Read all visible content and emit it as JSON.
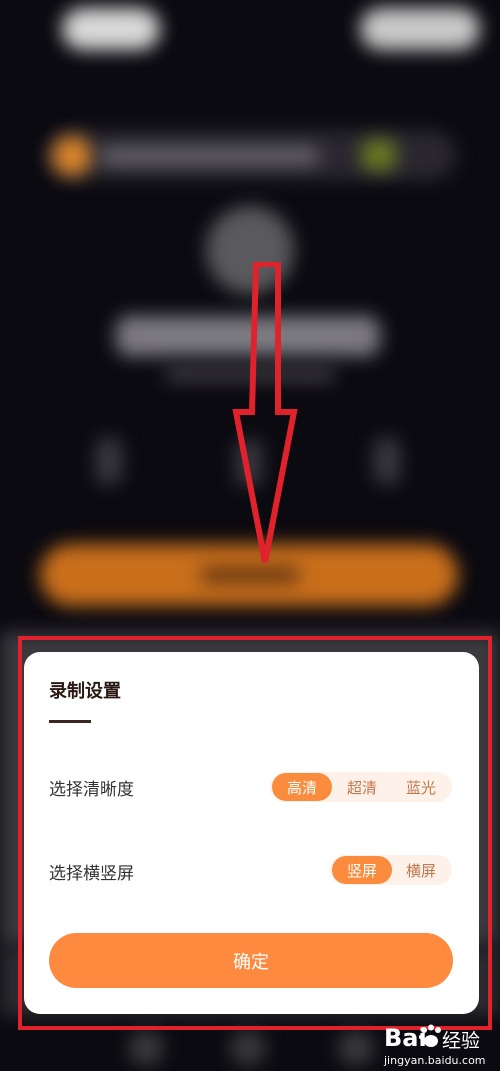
{
  "dialog": {
    "title": "录制设置",
    "resolution": {
      "label": "选择清晰度",
      "options": [
        "高清",
        "超清",
        "蓝光"
      ],
      "selected": "高清"
    },
    "orientation": {
      "label": "选择横竖屏",
      "options": [
        "竖屏",
        "横屏"
      ],
      "selected": "竖屏"
    },
    "confirm_label": "确定"
  },
  "watermark": {
    "logo_text": "Bai",
    "logo_suffix": "经验",
    "url": "jingyan.baidu.com"
  },
  "colors": {
    "accent": "#fb8c3e",
    "annotation_red": "#e0222c"
  }
}
